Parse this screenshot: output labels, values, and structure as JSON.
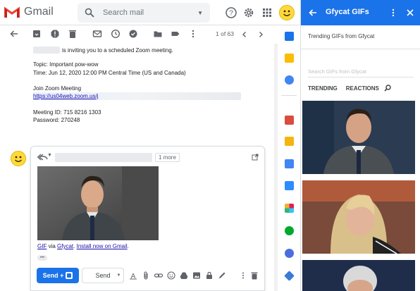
{
  "app": {
    "name": "Gmail"
  },
  "search": {
    "placeholder": "Search mail"
  },
  "toolbar": {
    "pager": "1 of 63"
  },
  "email": {
    "invite_line": "is inviting you to a scheduled Zoom meeting.",
    "topic": "Topic: Important pow-wow",
    "time": "Time: Jun 12, 2020 12:00 PM Central Time (US and Canada)",
    "join_label": "Join Zoom Meeting",
    "join_link": "https://us04web.zoom.us/j",
    "meeting_id": "Meeting ID: 715 8216 1303",
    "password": "Password: 270248"
  },
  "compose": {
    "more_label": "1 more",
    "attribution_gif": "GIF",
    "attribution_via": " via ",
    "attribution_source": "Gfycat",
    "attribution_sep": ". ",
    "attribution_install": "Install now on Gmail",
    "attribution_end": ".",
    "ellipsis": "•••",
    "send_label": "Send +",
    "send2_label": "Send"
  },
  "panel": {
    "title": "Gfycat GIFs",
    "subtitle": "Trending GIFs from Gfycat",
    "search_placeholder": "Search GIFs from Gfycat",
    "tabs": [
      "TRENDING",
      "REACTIONS"
    ]
  },
  "colors": {
    "accent": "#1a73e8",
    "gmail_red": "#ea4335"
  }
}
